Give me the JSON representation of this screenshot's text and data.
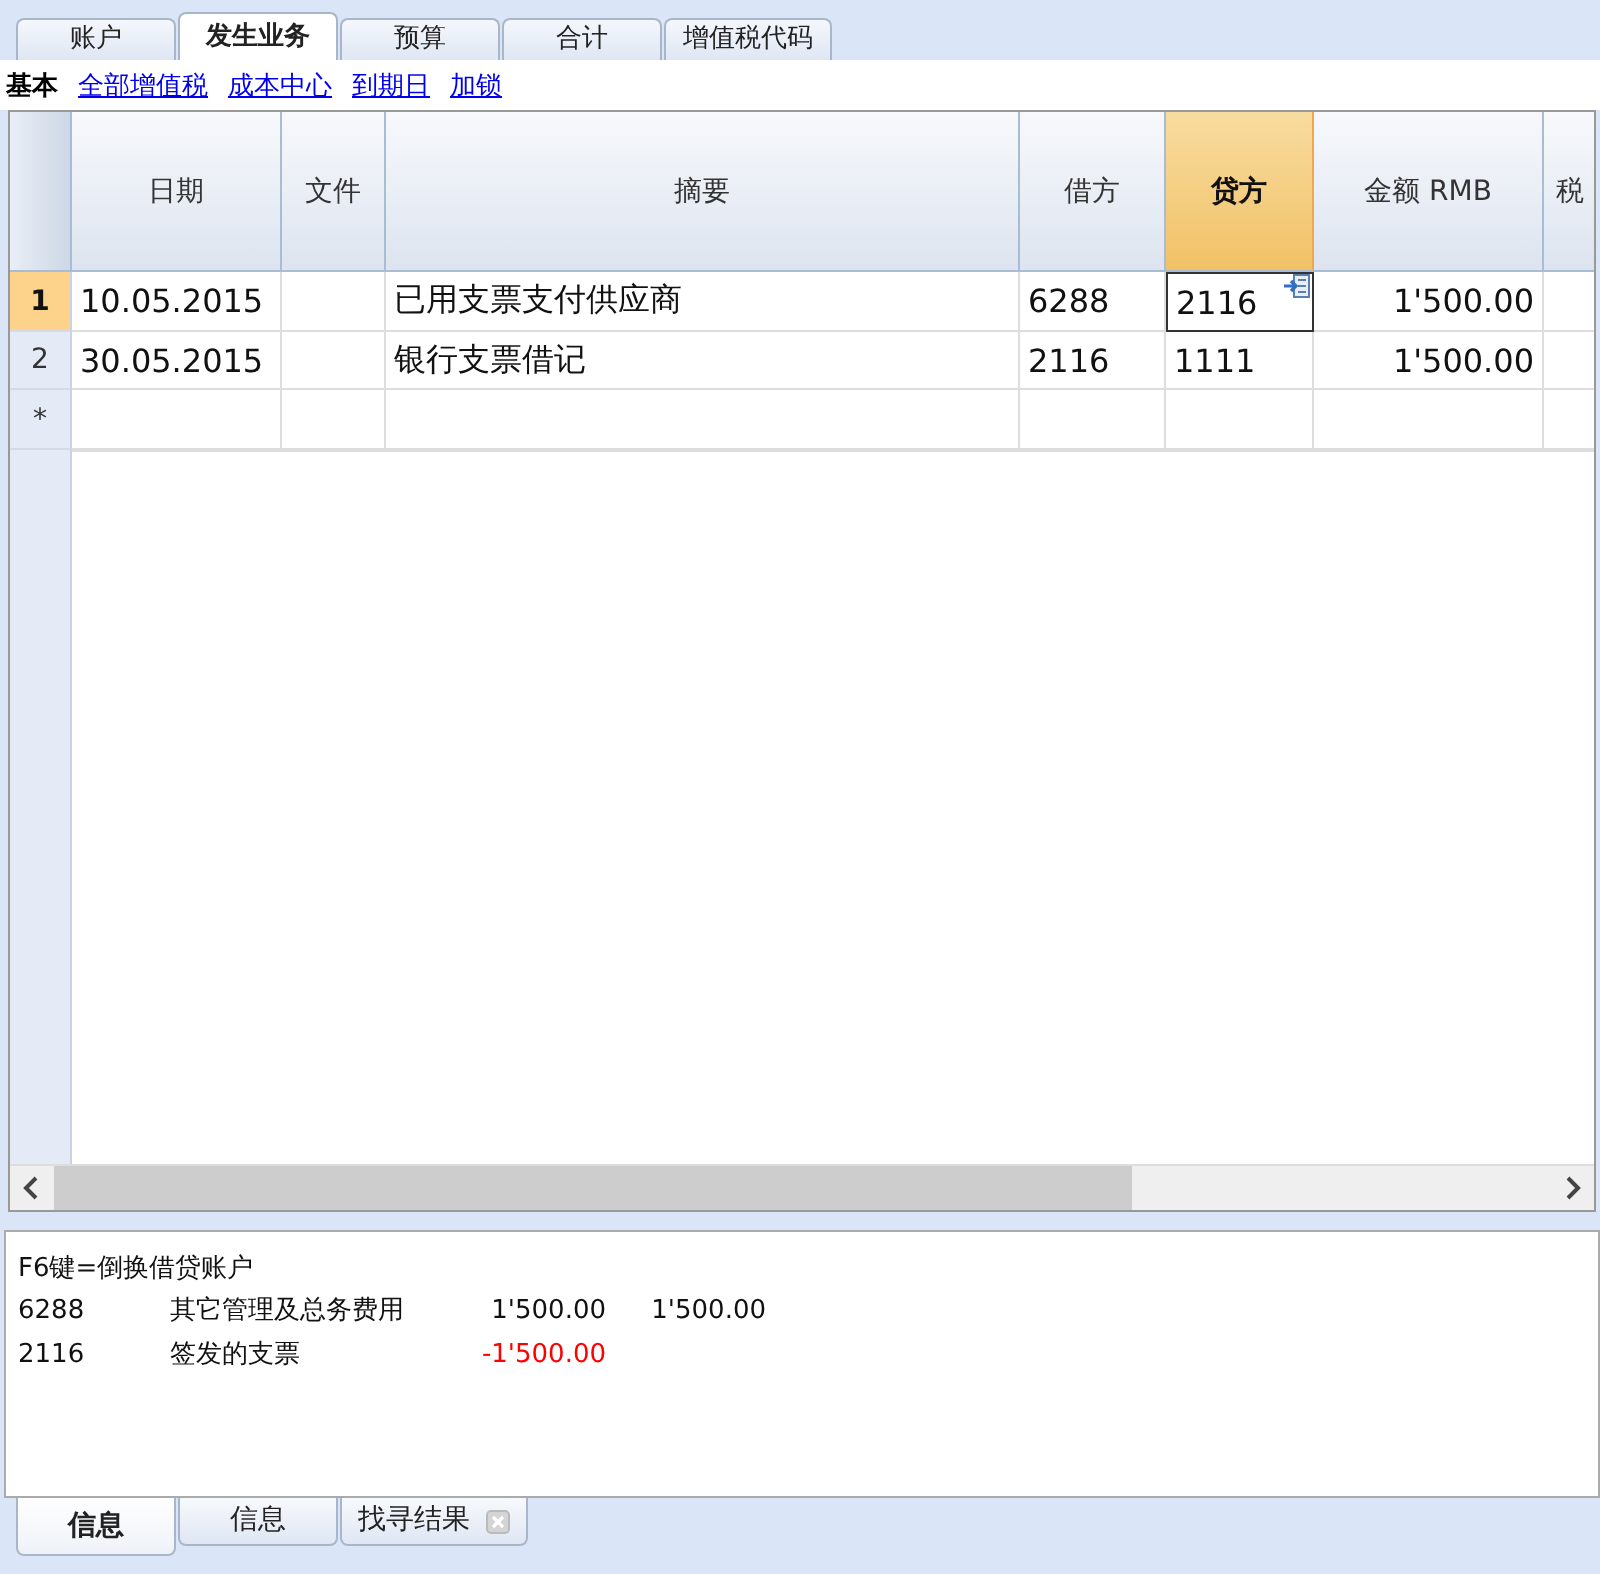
{
  "tabs": [
    {
      "label": "账户",
      "selected": false
    },
    {
      "label": "发生业务",
      "selected": true
    },
    {
      "label": "预算",
      "selected": false
    },
    {
      "label": "合计",
      "selected": false
    },
    {
      "label": "增值税代码",
      "selected": false
    }
  ],
  "views": [
    {
      "label": "基本",
      "selected": true
    },
    {
      "label": "全部增值税",
      "selected": false
    },
    {
      "label": "成本中心",
      "selected": false
    },
    {
      "label": "到期日",
      "selected": false
    },
    {
      "label": "加锁",
      "selected": false
    }
  ],
  "table": {
    "columns": [
      {
        "label": "日期",
        "selected": false
      },
      {
        "label": "文件",
        "selected": false
      },
      {
        "label": "摘要",
        "selected": false
      },
      {
        "label": "借方",
        "selected": false
      },
      {
        "label": "贷方",
        "selected": true
      },
      {
        "label": "金额 RMB",
        "selected": false
      },
      {
        "label": "税",
        "selected": false
      }
    ],
    "rows": [
      {
        "number": "1",
        "selected": true,
        "date": "10.05.2015",
        "description": "已用支票支付供应商",
        "debit": "6288",
        "credit": "2116",
        "amount": "1'500.00"
      },
      {
        "number": "2",
        "selected": false,
        "date": "30.05.2015",
        "description": "银行支票借记",
        "debit": "2116",
        "credit": "1111",
        "amount": "1'500.00"
      },
      {
        "number": "*",
        "selected": false
      }
    ]
  },
  "info": {
    "hint": "F6键=倒换借贷账户",
    "lines": [
      {
        "account": "6288",
        "name": "其它管理及总务费用",
        "amounts": [
          {
            "text": "1'500.00",
            "negative": false
          },
          {
            "text": "1'500.00",
            "negative": false
          }
        ]
      },
      {
        "account": "2116",
        "name": "签发的支票",
        "amounts": [
          {
            "text": "-1'500.00",
            "negative": true
          }
        ]
      }
    ]
  },
  "bottom_tabs": [
    {
      "label": "信息",
      "selected": true,
      "closable": false
    },
    {
      "label": "信息",
      "selected": false,
      "closable": false
    },
    {
      "label": "找寻结果",
      "selected": false,
      "closable": true
    }
  ]
}
